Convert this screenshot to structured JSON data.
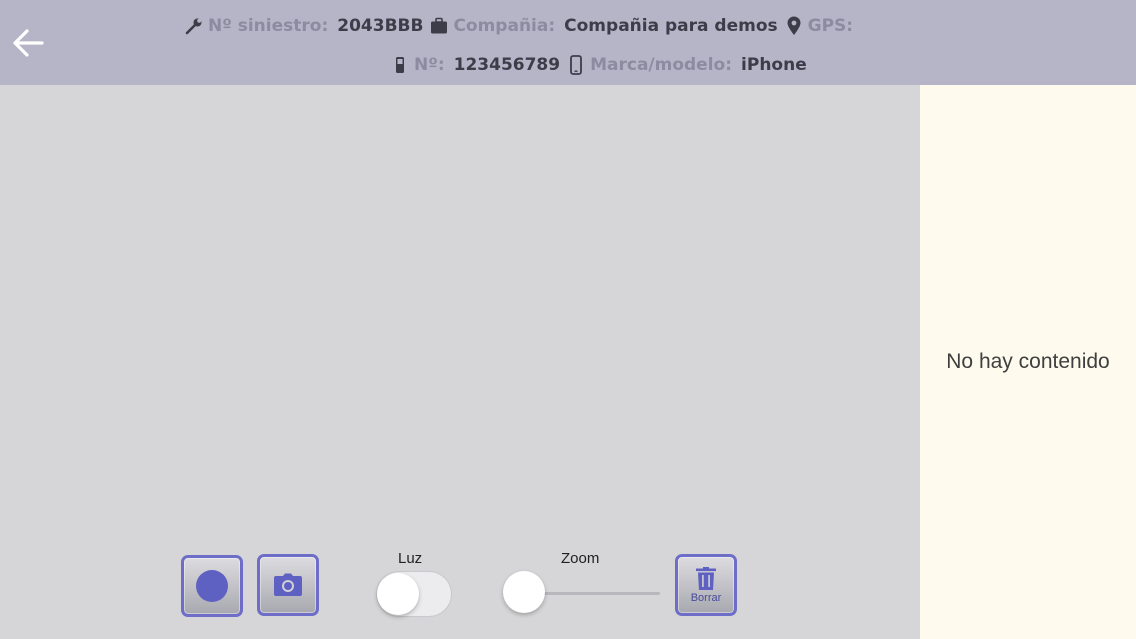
{
  "header": {
    "siniestro_label": "Nº siniestro:",
    "siniestro_value": "2043BBB",
    "compania_label": "Compañia:",
    "compania_value": "Compañia para demos",
    "gps_label": "GPS:",
    "gps_value": "",
    "numero_label": "Nº:",
    "numero_value": "123456789",
    "marca_label": "Marca/modelo:",
    "marca_value": "iPhone",
    "icons": [
      "wrench-icon",
      "briefcase-icon",
      "map-pin-icon",
      "mobile-phone-icon",
      "smartphone-icon"
    ]
  },
  "side_panel": {
    "empty_message": "No hay contenido"
  },
  "controls": {
    "luz_label": "Luz",
    "luz_on": false,
    "zoom_label": "Zoom",
    "zoom_value": 0,
    "delete_label": "Borrar"
  },
  "colors": {
    "header_bg": "#b6b5c8",
    "accent": "#5e60c2",
    "panel_bg": "#fefbee",
    "camera_bg": "#d6d6d8"
  }
}
